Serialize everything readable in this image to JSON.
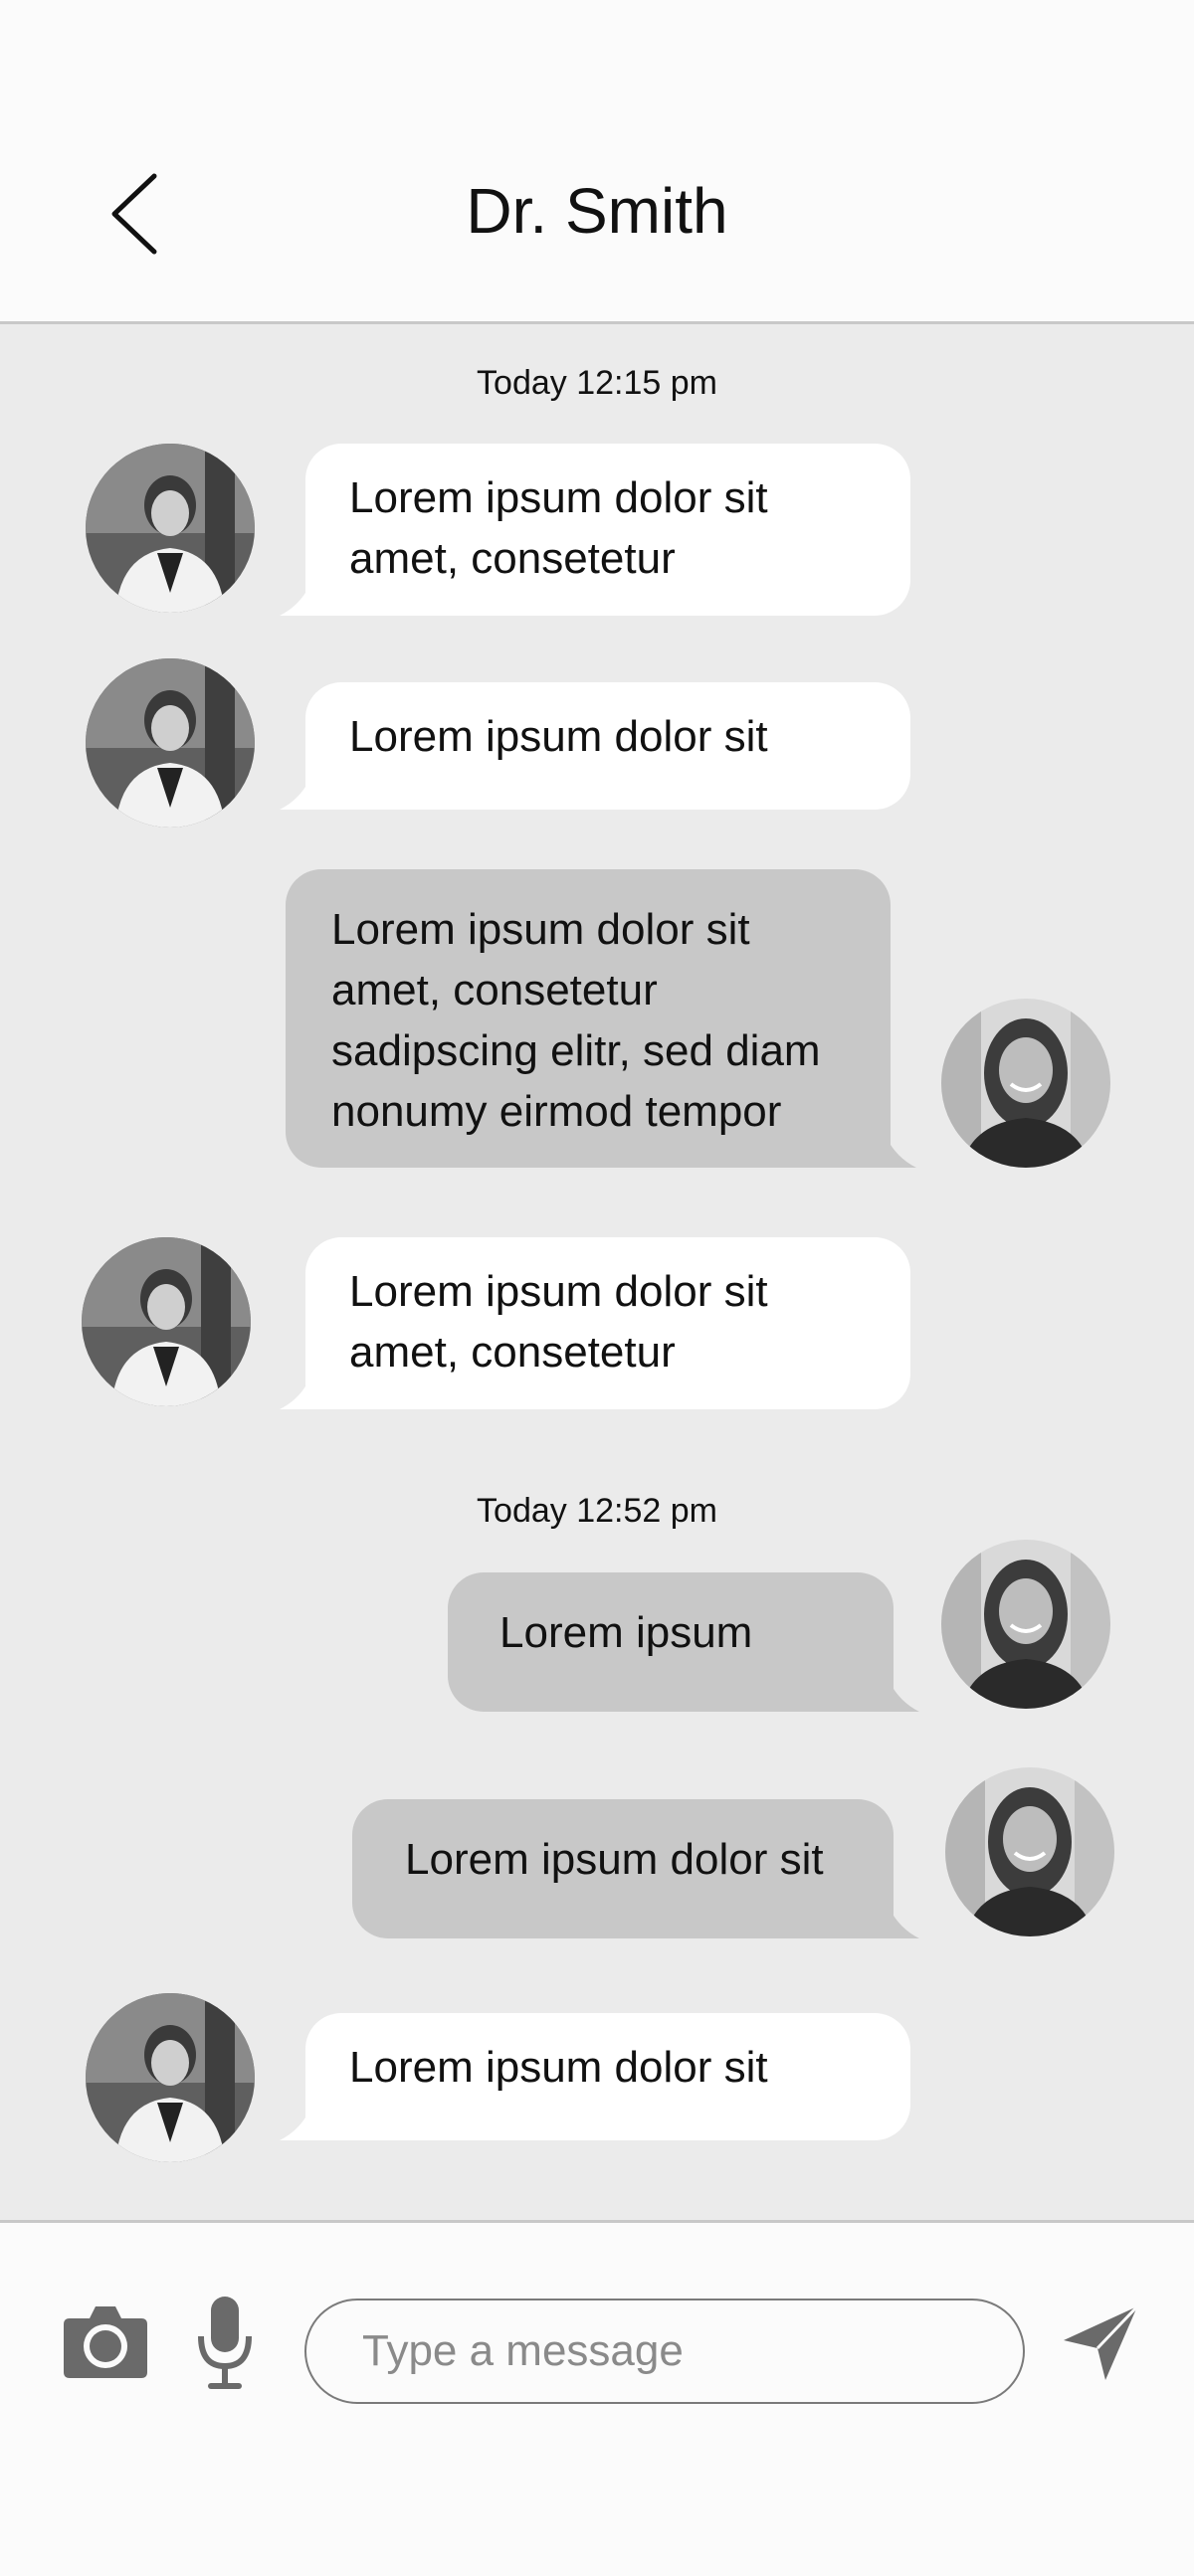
{
  "header": {
    "title": "Dr. Smith",
    "back_icon": "chevron-left-icon"
  },
  "chat": {
    "groups": [
      {
        "timestamp": "Today 12:15 pm",
        "messages": [
          {
            "sender": "doctor",
            "text": "Lorem ipsum dolor sit amet, consetetur"
          },
          {
            "sender": "doctor",
            "text": "Lorem ipsum dolor sit"
          },
          {
            "sender": "patient",
            "text": "Lorem ipsum dolor sit amet, consetetur sadipscing elitr, sed diam nonumy eirmod tempor"
          },
          {
            "sender": "doctor",
            "text": "Lorem ipsum dolor sit amet, consetetur"
          }
        ]
      },
      {
        "timestamp": "Today 12:52 pm",
        "messages": [
          {
            "sender": "patient",
            "text": "Lorem ipsum"
          },
          {
            "sender": "patient",
            "text": "Lorem ipsum dolor sit"
          },
          {
            "sender": "doctor",
            "text": "Lorem ipsum dolor sit"
          }
        ]
      }
    ]
  },
  "composer": {
    "placeholder": "Type a message",
    "value": "",
    "camera_icon": "camera-icon",
    "mic_icon": "microphone-icon",
    "send_icon": "send-icon"
  },
  "colors": {
    "chat_background": "#ebebeb",
    "incoming_bubble": "#ffffff",
    "outgoing_bubble": "#c8c8c8",
    "header_background": "#fbfbfb",
    "icon_gray": "#6a6a6a"
  }
}
